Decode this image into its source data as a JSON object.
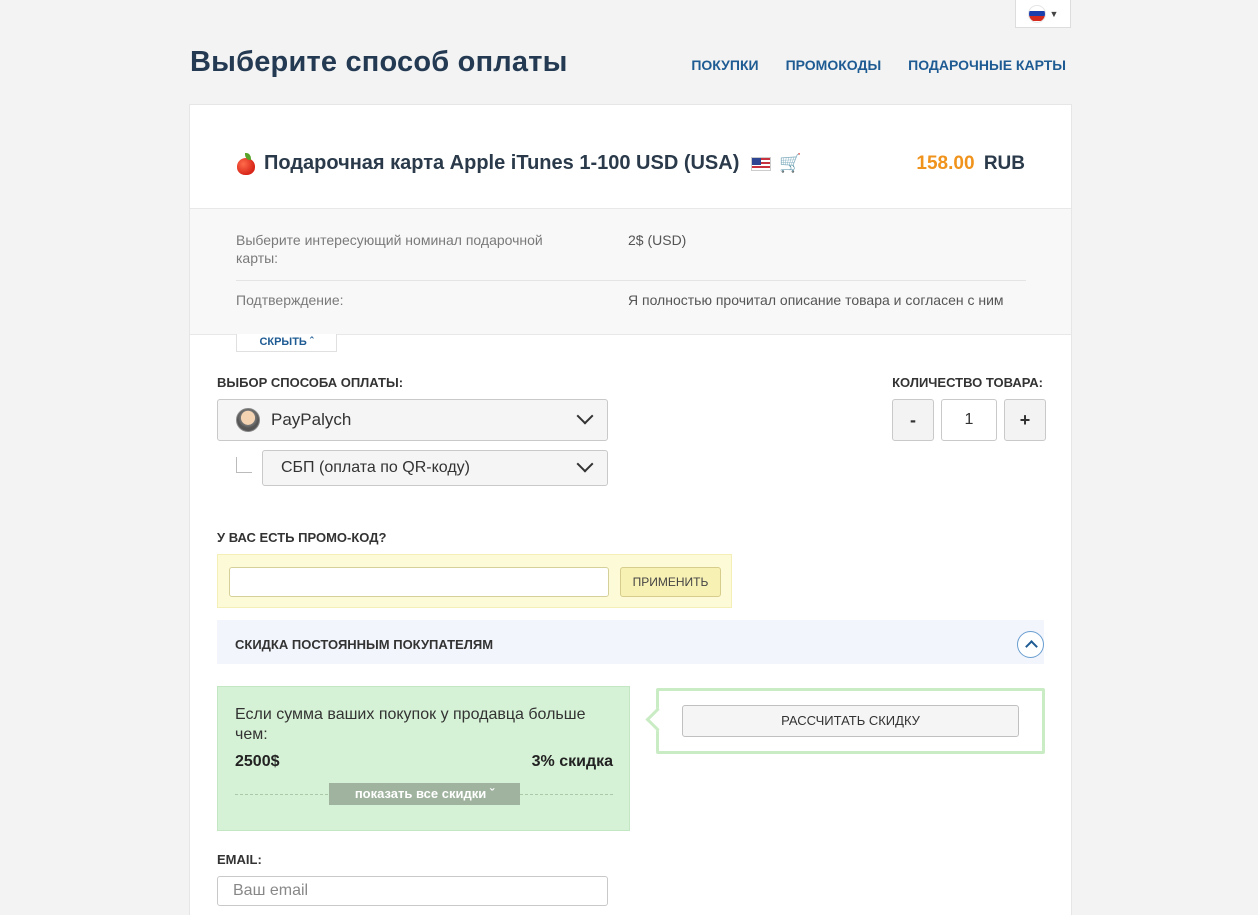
{
  "header": {
    "title": "Выберите способ оплаты",
    "nav": [
      "ПОКУПКИ",
      "ПРОМОКОДЫ",
      "ПОДАРОЧНЫЕ КАРТЫ"
    ],
    "language_icon": "flag-ru-icon"
  },
  "product": {
    "title": "Подарочная карта Apple iTunes 1-100 USD (USA)",
    "price": "158.00",
    "currency": "RUB"
  },
  "options": [
    {
      "label": "Выберите интересующий номинал подарочной карты:",
      "value": "2$ (USD)"
    },
    {
      "label": "Подтверждение:",
      "value": "Я полностью прочитал описание товара и согласен с ним"
    }
  ],
  "hide_label": "СКРЫТЬ",
  "payment": {
    "label": "ВЫБОР СПОСОБА ОПЛАТЫ:",
    "method": "PayPalych",
    "submethod": "СБП (оплата по QR-коду)"
  },
  "quantity": {
    "label": "КОЛИЧЕСТВО ТОВАРА:",
    "minus": "-",
    "value": "1",
    "plus": "+"
  },
  "promo": {
    "label": "У ВАС ЕСТЬ ПРОМО-КОД?",
    "placeholder": "",
    "apply": "ПРИМЕНИТЬ"
  },
  "loyalty": {
    "title": "СКИДКА ПОСТОЯННЫМ ПОКУПАТЕЛЯМ",
    "text": "Если сумма ваших покупок у продавца больше чем:",
    "amount": "2500$",
    "percent": "3% скидка",
    "show_all": "показать все скидки",
    "calc": "РАССЧИТАТЬ СКИДКУ"
  },
  "email": {
    "label": "EMAIL:",
    "placeholder": "Ваш email"
  },
  "colors": {
    "accent": "#1e5b93",
    "price": "#f0931c",
    "promo_bg": "#fdfbd7",
    "discount_bg": "#d6f2d6"
  }
}
